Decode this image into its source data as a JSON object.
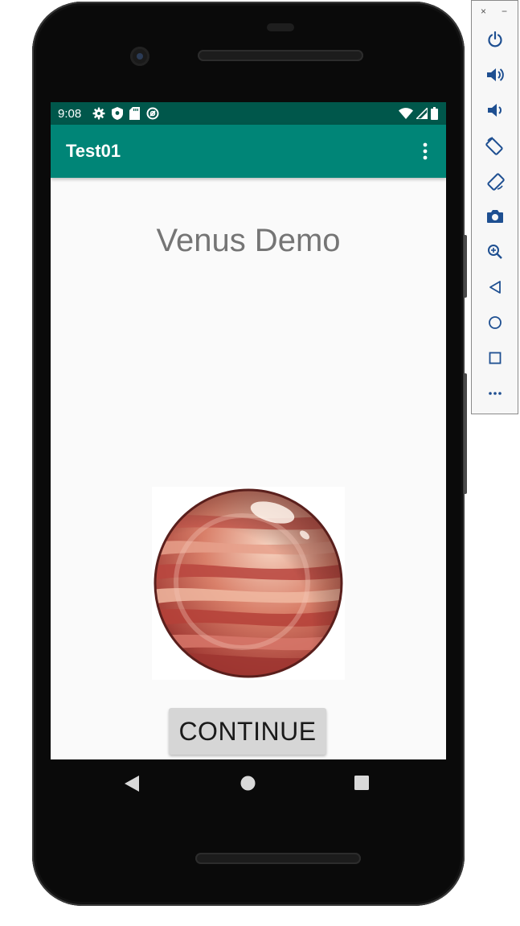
{
  "status_bar": {
    "time": "9:08",
    "left_icons": [
      "settings-icon",
      "shield-icon",
      "sd-card-icon",
      "sync-icon"
    ],
    "right_icons": [
      "wifi-icon",
      "signal-icon",
      "battery-icon"
    ]
  },
  "app_bar": {
    "title": "Test01",
    "overflow_icon": "more-vert-icon"
  },
  "main": {
    "title": "Venus Demo",
    "image": "venus-planet-image",
    "continue_label": "CONTINUE"
  },
  "nav_bar": {
    "items": [
      "back-icon",
      "home-icon",
      "recents-icon"
    ]
  },
  "emulator_toolbar": {
    "close_glyph": "×",
    "minimize_glyph": "−",
    "buttons": [
      "power-icon",
      "volume-up-icon",
      "volume-down-icon",
      "rotate-left-icon",
      "rotate-right-icon",
      "camera-icon",
      "zoom-icon",
      "back-icon",
      "home-icon",
      "overview-icon",
      "more-icon"
    ]
  },
  "colors": {
    "status_bar": "#00574b",
    "app_bar": "#008577",
    "screen_bg": "#fafafa",
    "title_text": "#757575",
    "button_bg": "#d6d6d6"
  }
}
